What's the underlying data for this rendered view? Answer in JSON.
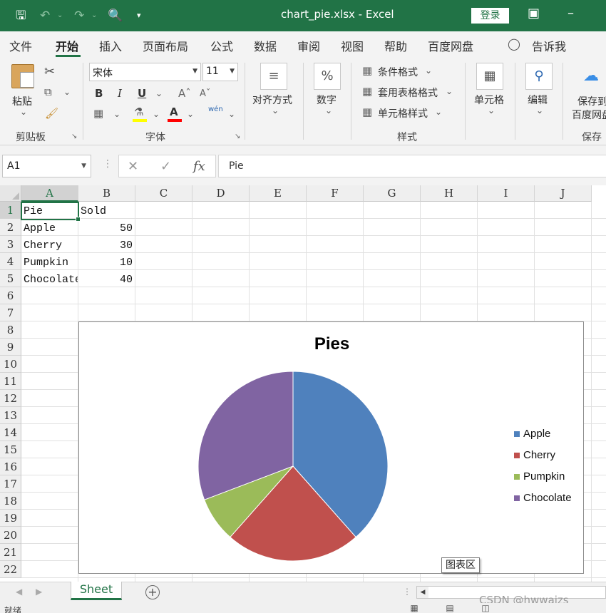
{
  "titlebar": {
    "title": "chart_pie.xlsx  -  Excel",
    "login": "登录"
  },
  "tabs": [
    "文件",
    "开始",
    "插入",
    "页面布局",
    "公式",
    "数据",
    "审阅",
    "视图",
    "帮助",
    "百度网盘",
    "告诉我"
  ],
  "ribbon": {
    "clipboard": {
      "paste": "粘贴",
      "label": "剪贴板"
    },
    "font": {
      "name": "宋体",
      "size": "11",
      "label": "字体",
      "bold": "B",
      "italic": "I",
      "underline": "U",
      "font_color_glyph": "A",
      "phonetic": "wén"
    },
    "alignment": "对齐方式",
    "number": "数字",
    "styles": {
      "conditional": "条件格式",
      "table": "套用表格格式",
      "cell": "单元格样式",
      "label": "样式"
    },
    "cells": "单元格",
    "editing": "编辑",
    "save": {
      "line1": "保存到",
      "line2": "百度网盘",
      "label": "保存"
    }
  },
  "formula_bar": {
    "name_box": "A1",
    "formula": "Pie"
  },
  "columns": [
    "A",
    "B",
    "C",
    "D",
    "E",
    "F",
    "G",
    "H",
    "I",
    "J"
  ],
  "rows": [
    "1",
    "2",
    "3",
    "4",
    "5",
    "6",
    "7",
    "8",
    "9",
    "10",
    "11",
    "12",
    "13",
    "14",
    "15",
    "16",
    "17",
    "18",
    "19",
    "20",
    "21",
    "22"
  ],
  "cells": {
    "A1": "Pie",
    "B1": "Sold",
    "A2": "Apple",
    "B2": "50",
    "A3": "Cherry",
    "B3": "30",
    "A4": "Pumpkin",
    "B4": "10",
    "A5": "Chocolate",
    "B5": "40"
  },
  "chart_tooltip": "图表区",
  "sheet": {
    "tab": "Sheet"
  },
  "watermark": "CSDN @hwwaizs",
  "status": "就绪",
  "chart_data": {
    "type": "pie",
    "title": "Pies",
    "categories": [
      "Apple",
      "Cherry",
      "Pumpkin",
      "Chocolate"
    ],
    "values": [
      50,
      30,
      10,
      40
    ],
    "colors": [
      "#4f81bd",
      "#c0504d",
      "#9bbb59",
      "#8064a2"
    ],
    "legend": "right"
  }
}
